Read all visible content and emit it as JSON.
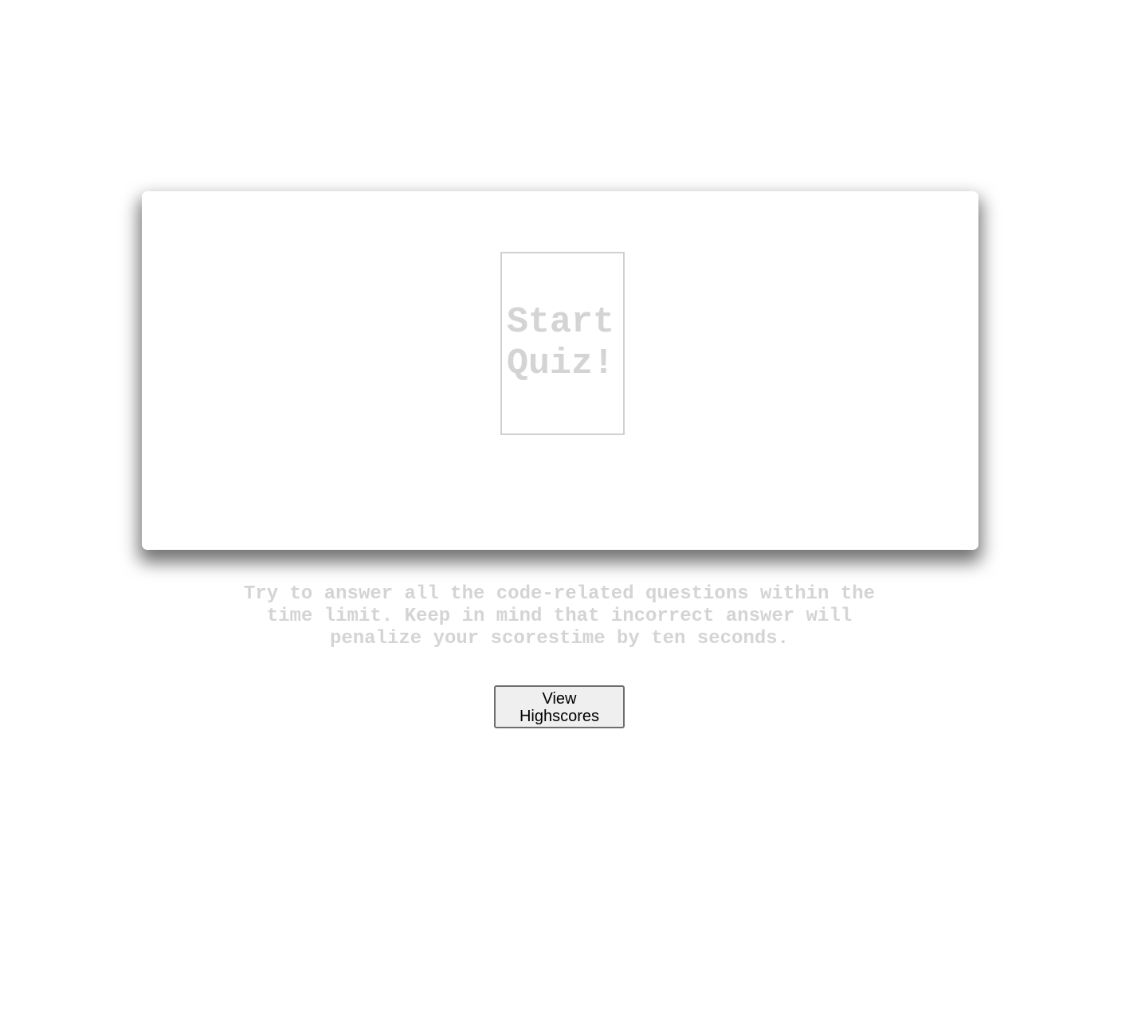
{
  "quiz_card": {
    "start_button_line1": "Start",
    "start_button_line2": "Quiz!"
  },
  "instructions": {
    "line1": "Try to answer all the code-related questions within the",
    "line2": "time limit. Keep in mind that incorrect answer will",
    "line3": "penalize your scorestime by ten seconds."
  },
  "highscores_button_label": "View Highscores",
  "colors": {
    "background": "#ffffff",
    "muted_text": "#d4d4d4",
    "button_face": "#efefef"
  }
}
